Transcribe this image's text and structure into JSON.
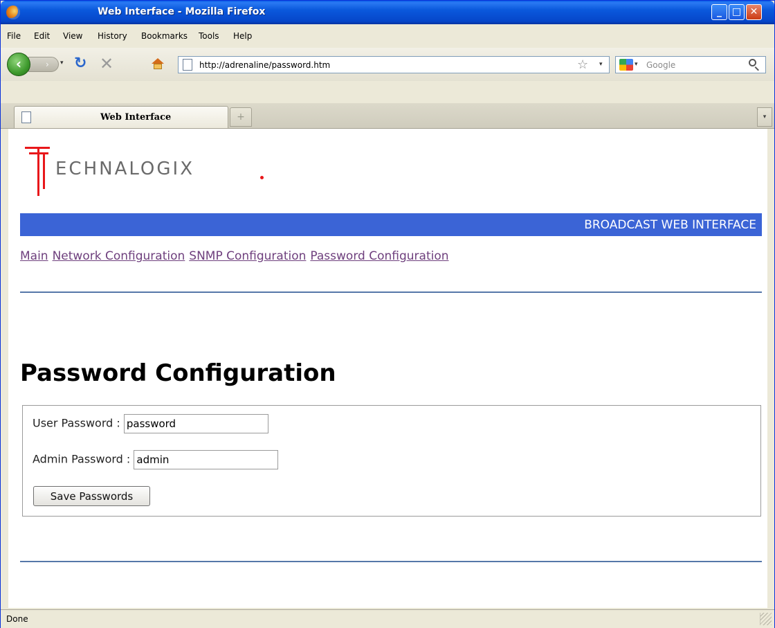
{
  "window": {
    "title": "Web Interface - Mozilla Firefox",
    "controls": {
      "minimize": "_",
      "maximize": "□",
      "close": "✕"
    }
  },
  "menu": {
    "items": [
      "File",
      "Edit",
      "View",
      "History",
      "Bookmarks",
      "Tools",
      "Help"
    ]
  },
  "toolbar": {
    "back": "‹",
    "forward": "›",
    "dropdown": "▾",
    "reload": "↻",
    "stop": "✕",
    "url": "http://adrenaline/password.htm",
    "bookmark_star": "☆",
    "search_placeholder": "Google"
  },
  "tabs": {
    "active_label": "Web Interface",
    "new_tab": "+",
    "list_all": "▾"
  },
  "page": {
    "logo_text": "ECHNALOGIX",
    "banner": "BROADCAST WEB INTERFACE",
    "nav_links": [
      "Main",
      "Network Configuration",
      "SNMP Configuration",
      "Password Configuration"
    ],
    "title": "Password Configuration",
    "form": {
      "user_label": "User Password :",
      "user_value": "password",
      "admin_label": "Admin Password :",
      "admin_value": "admin",
      "save_label": "Save Passwords"
    }
  },
  "status": {
    "text": "Done"
  },
  "colors": {
    "banner": "#3b64d6",
    "logo_red": "#e8171a",
    "link_visited": "#6e3f7d",
    "rule": "#5577a8"
  }
}
